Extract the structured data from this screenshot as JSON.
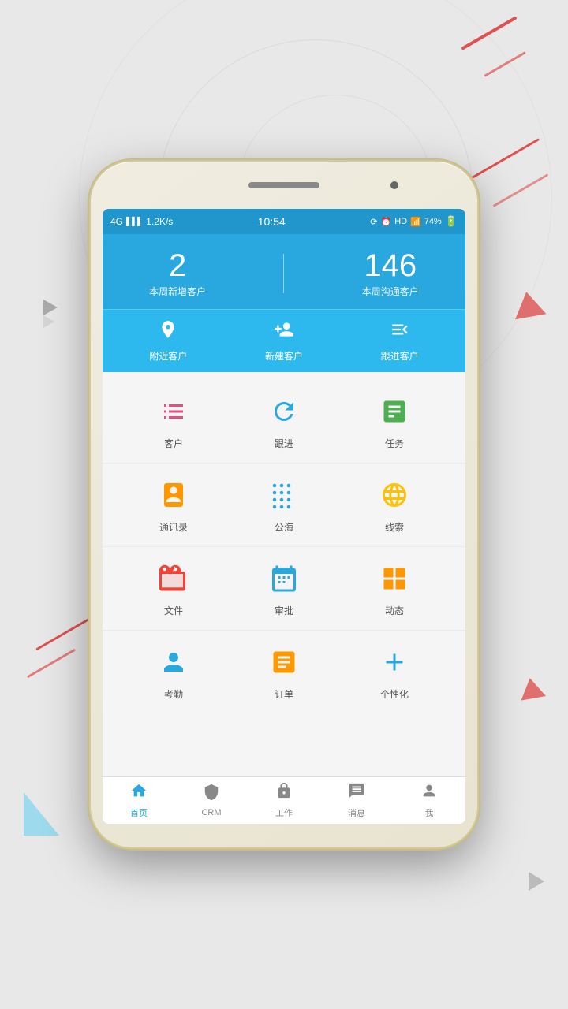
{
  "background": {
    "color": "#e5e5e5"
  },
  "statusBar": {
    "network": "4G",
    "signal": "📶",
    "speed": "1.2K/s",
    "time": "10:54",
    "battery": "74%",
    "batteryIcon": "🔋",
    "hd": "HD",
    "wifi": "WiFi"
  },
  "header": {
    "stat1": {
      "number": "2",
      "label": "本周新增客户"
    },
    "stat2": {
      "number": "146",
      "label": "本周沟通客户"
    }
  },
  "quickActions": [
    {
      "id": "nearby",
      "label": "附近客户",
      "icon": "📍"
    },
    {
      "id": "new-client",
      "label": "新建客户",
      "icon": "👥"
    },
    {
      "id": "follow-up",
      "label": "跟进客户",
      "icon": "📋"
    }
  ],
  "iconGrid": [
    [
      {
        "id": "customer",
        "label": "客户",
        "icon": "grid",
        "color": "pink"
      },
      {
        "id": "follow",
        "label": "跟进",
        "icon": "refresh",
        "color": "blue"
      },
      {
        "id": "task",
        "label": "任务",
        "icon": "list",
        "color": "green"
      }
    ],
    [
      {
        "id": "contacts",
        "label": "通讯录",
        "icon": "book",
        "color": "orange"
      },
      {
        "id": "public-sea",
        "label": "公海",
        "icon": "dots",
        "color": "blue"
      },
      {
        "id": "clues",
        "label": "线索",
        "icon": "globe",
        "color": "yellow"
      }
    ],
    [
      {
        "id": "files",
        "label": "文件",
        "icon": "briefcase",
        "color": "red"
      },
      {
        "id": "approval",
        "label": "审批",
        "icon": "calendar",
        "color": "blue"
      },
      {
        "id": "dynamic",
        "label": "动态",
        "icon": "squares",
        "color": "orange"
      }
    ],
    [
      {
        "id": "attendance",
        "label": "考勤",
        "icon": "person",
        "color": "blue"
      },
      {
        "id": "order",
        "label": "订单",
        "icon": "clipboard",
        "color": "orange"
      },
      {
        "id": "customize",
        "label": "个性化",
        "icon": "plus",
        "color": "blue"
      }
    ]
  ],
  "bottomNav": [
    {
      "id": "home",
      "label": "首页",
      "icon": "🏠",
      "active": true
    },
    {
      "id": "crm",
      "label": "CRM",
      "icon": "🛡",
      "active": false
    },
    {
      "id": "work",
      "label": "工作",
      "icon": "🔒",
      "active": false
    },
    {
      "id": "message",
      "label": "消息",
      "icon": "💬",
      "active": false
    },
    {
      "id": "me",
      "label": "我",
      "icon": "👤",
      "active": false
    }
  ]
}
